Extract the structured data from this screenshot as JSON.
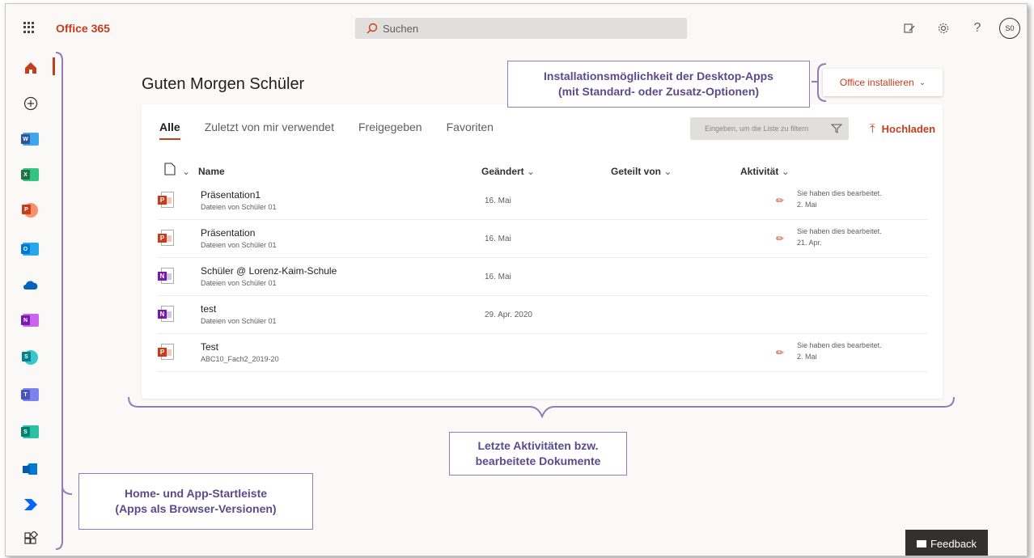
{
  "topbar": {
    "brand": "Office 365",
    "search_placeholder": "Suchen",
    "avatar_initials": "S0"
  },
  "colors": {
    "accent": "#c43e1c",
    "annotation": "#8f7cb8"
  },
  "rail": {
    "items": [
      {
        "name": "home-icon"
      },
      {
        "name": "create-icon"
      },
      {
        "name": "word-app-icon",
        "letter": "W",
        "color": "#2b579a"
      },
      {
        "name": "excel-app-icon",
        "letter": "X",
        "color": "#217346"
      },
      {
        "name": "powerpoint-app-icon",
        "letter": "P",
        "color": "#c43e1c"
      },
      {
        "name": "outlook-app-icon",
        "letter": "O",
        "color": "#0078d4"
      },
      {
        "name": "onedrive-app-icon"
      },
      {
        "name": "onenote-app-icon",
        "letter": "N",
        "color": "#7719aa"
      },
      {
        "name": "sharepoint-app-icon",
        "letter": "S",
        "color": "#038387"
      },
      {
        "name": "teams-app-icon",
        "letter": "T",
        "color": "#6264a7"
      },
      {
        "name": "sway-app-icon",
        "letter": "S",
        "color": "#008272"
      },
      {
        "name": "forms-app-icon",
        "letter": "F",
        "color": "#0078d4"
      },
      {
        "name": "power-automate-app-icon"
      },
      {
        "name": "all-apps-icon"
      }
    ]
  },
  "main": {
    "greeting": "Guten Morgen Schüler",
    "install_label": "Office installieren",
    "tabs": [
      {
        "label": "Alle",
        "active": true
      },
      {
        "label": "Zuletzt von mir verwendet",
        "active": false
      },
      {
        "label": "Freigegeben",
        "active": false
      },
      {
        "label": "Favoriten",
        "active": false
      }
    ],
    "filter_placeholder": "Eingeben, um die Liste zu filtern",
    "upload_label": "Hochladen",
    "columns": {
      "name": "Name",
      "modified": "Geändert",
      "shared_by": "Geteilt von",
      "activity": "Aktivität"
    },
    "files": [
      {
        "name": "Präsentation1",
        "location": "Dateien von Schüler 01",
        "date": "16. Mai",
        "type": "ppt",
        "activity": "Sie haben dies bearbeitet.",
        "activity_date": "2. Mai"
      },
      {
        "name": "Präsentation",
        "location": "Dateien von Schüler 01",
        "date": "16. Mai",
        "type": "ppt",
        "activity": "Sie haben dies bearbeitet.",
        "activity_date": "21. Apr."
      },
      {
        "name": "Schüler @ Lorenz-Kaim-Schule",
        "location": "Dateien von Schüler 01",
        "date": "16. Mai",
        "type": "one",
        "activity": "",
        "activity_date": ""
      },
      {
        "name": "test",
        "location": "Dateien von Schüler 01",
        "date": "29. Apr. 2020",
        "type": "one",
        "activity": "",
        "activity_date": ""
      },
      {
        "name": "Test",
        "location": "ABC10_Fach2_2019-20",
        "date": "",
        "type": "ppt",
        "activity": "Sie haben dies bearbeitet.",
        "activity_date": "2. Mai"
      }
    ]
  },
  "feedback_label": "Feedback",
  "annotations": {
    "install": {
      "line1": "Installationsmöglichkeit der Desktop-Apps",
      "line2": "(mit Standard- oder Zusatz-Optionen)"
    },
    "recent": {
      "line1": "Letzte Aktivitäten bzw.",
      "line2": "bearbeitete Dokumente"
    },
    "rail": {
      "line1": "Home- und App-Startleiste",
      "line2": "(Apps als Browser-Versionen)"
    }
  }
}
